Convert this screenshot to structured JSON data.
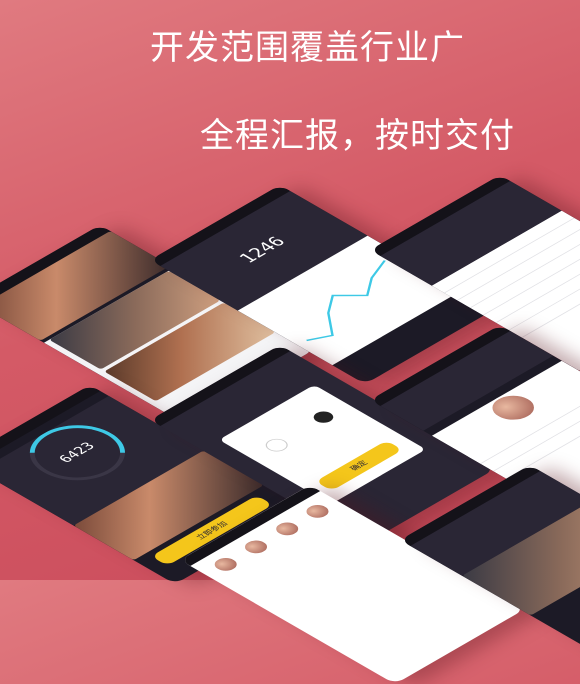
{
  "headline": {
    "line1": "开发范围覆盖行业广",
    "line2": "全程汇报，按时交付"
  },
  "screens": {
    "step_counter": {
      "value": "1246"
    },
    "step_ring": {
      "value": "6423"
    },
    "modal_button": {
      "label": "确定"
    },
    "promo_button": {
      "label": "立即参加"
    }
  },
  "colors": {
    "background": "#d45a66",
    "accent_yellow": "#f4c61b",
    "accent_cyan": "#3ec9e6"
  }
}
